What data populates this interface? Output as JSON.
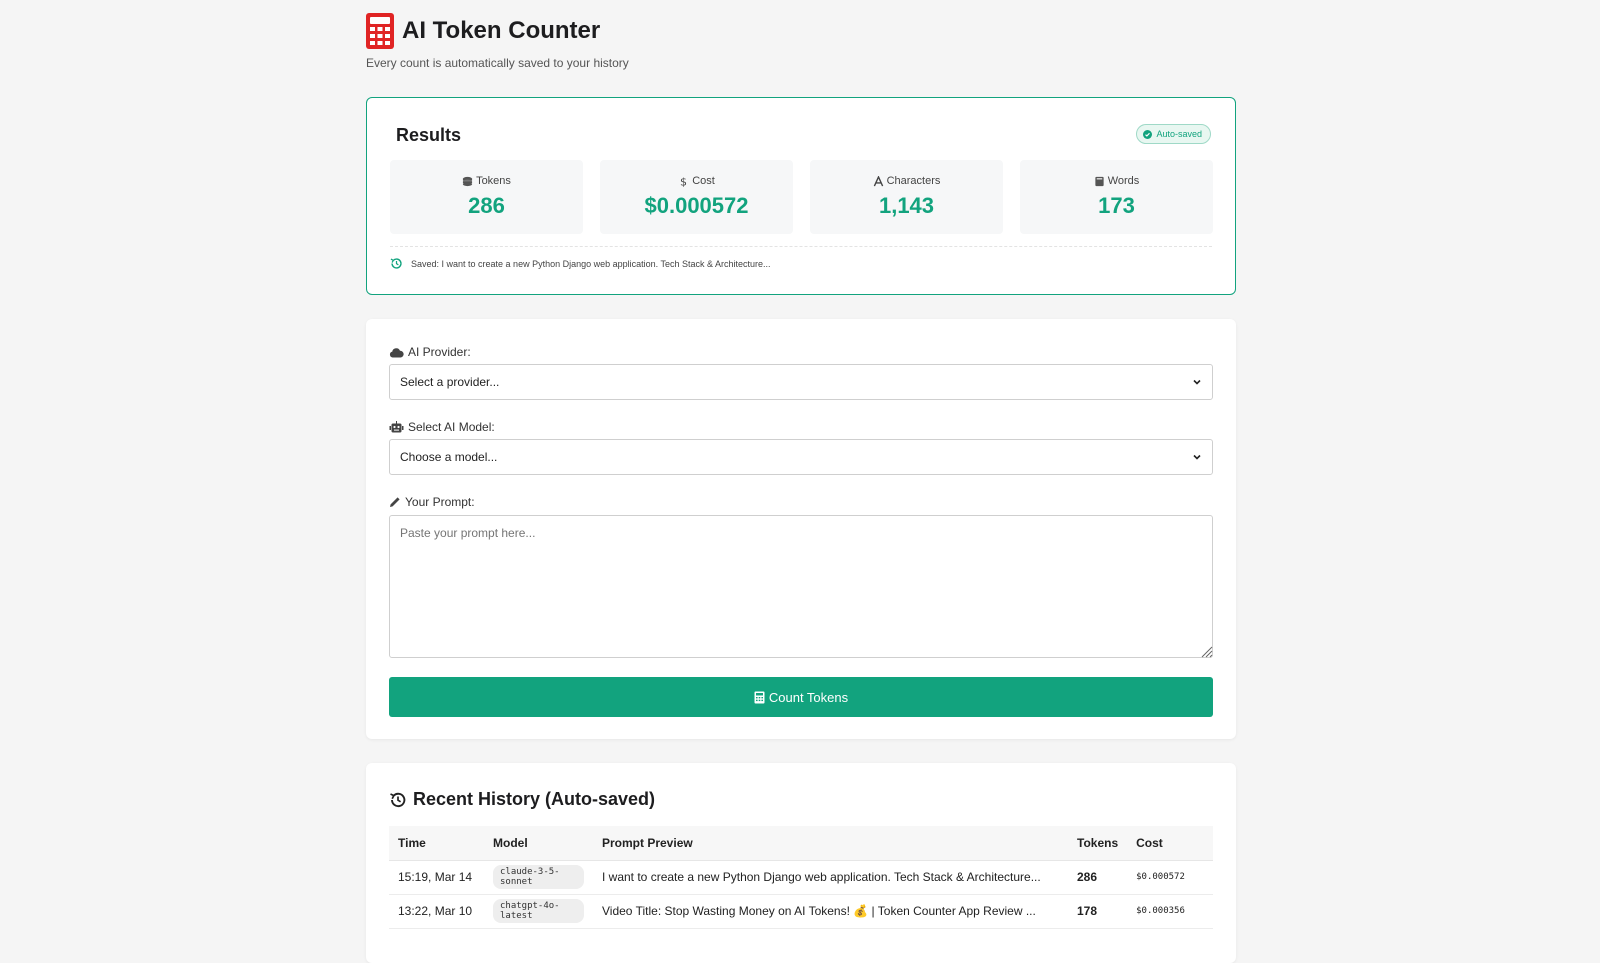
{
  "header": {
    "title": "AI Token Counter",
    "subtitle": "Every count is automatically saved to your history",
    "icon": "calculator-icon",
    "icon_color": "#e02424"
  },
  "colors": {
    "accent": "#12a37e",
    "background": "#f5f5f5"
  },
  "results": {
    "title": "Results",
    "badge": "Auto-saved",
    "stats": [
      {
        "label": "Tokens",
        "value": "286",
        "icon": "coins-icon"
      },
      {
        "label": "Cost",
        "value": "$0.000572",
        "icon": "dollar-icon"
      },
      {
        "label": "Characters",
        "value": "1,143",
        "icon": "font-icon"
      },
      {
        "label": "Words",
        "value": "173",
        "icon": "book-icon"
      }
    ],
    "saved_text": "Saved: I want to create a new Python Django web application. Tech Stack & Architecture..."
  },
  "form": {
    "provider_label": "AI Provider:",
    "provider_value": "Select a provider...",
    "model_label": "Select AI Model:",
    "model_value": "Choose a model...",
    "prompt_label": "Your Prompt:",
    "prompt_placeholder": "Paste your prompt here...",
    "button_label": "Count Tokens"
  },
  "history": {
    "title": "Recent History (Auto-saved)",
    "columns": [
      "Time",
      "Model",
      "Prompt Preview",
      "Tokens",
      "Cost"
    ],
    "rows": [
      {
        "time": "15:19, Mar 14",
        "model": "claude-3-5-sonnet",
        "preview": "I want to create a new Python Django web application. Tech Stack & Architecture...",
        "tokens": "286",
        "cost": "$0.000572"
      },
      {
        "time": "13:22, Mar 10",
        "model": "chatgpt-4o-latest",
        "preview": "Video Title: Stop Wasting Money on AI Tokens! 💰 | Token Counter App Review ...",
        "tokens": "178",
        "cost": "$0.000356"
      }
    ]
  }
}
